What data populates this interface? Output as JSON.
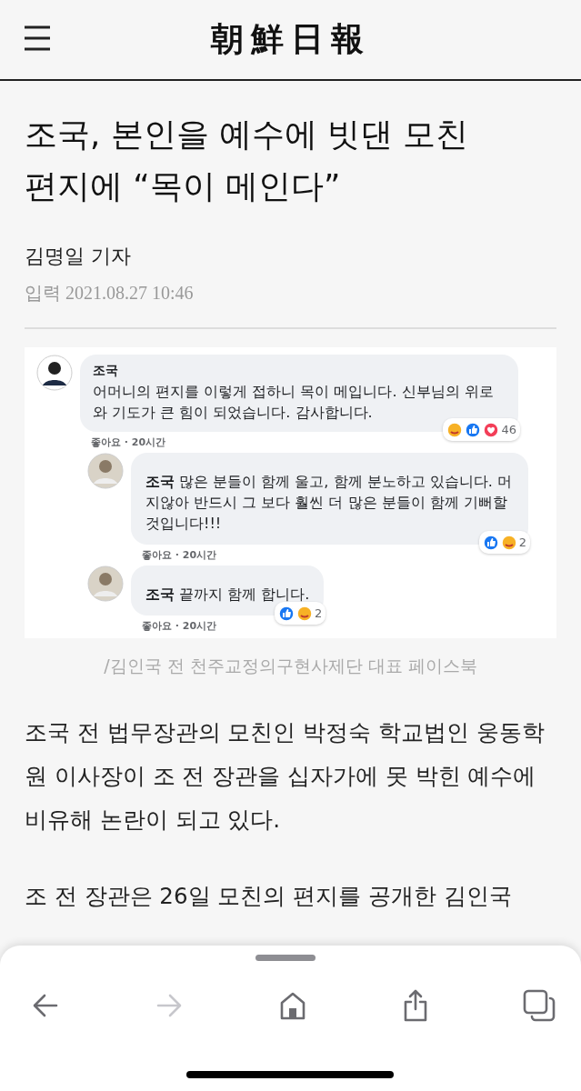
{
  "header": {
    "logo": "朝鮮日報"
  },
  "article": {
    "title": "조국, 본인을 예수에 빗댄 모친 편지에 “목이 메인다”",
    "byline": "김명일 기자",
    "date_label": "입력",
    "date": "2021.08.27 10:46"
  },
  "figure": {
    "comments": [
      {
        "author": "조국",
        "text": "어머니의 편지를 이렇게 접하니 목이 메입니다. 신부님의 위로와 기도가 큰 힘이 되었습니다. 감사합니다.",
        "reactions": [
          {
            "kind": "care"
          },
          {
            "kind": "like"
          },
          {
            "kind": "love"
          }
        ],
        "count": "46",
        "meta": "좋아요 · 20시간",
        "replies": [
          {
            "text": "**조국** 많은 분들이 함께 울고, 함께 분노하고 있습니다. 머지않아 반드시 그 보다 훨씬 더 많은 분들이 함께 기뻐할 것입니다!!!",
            "reactions": [
              {
                "kind": "like"
              },
              {
                "kind": "care"
              }
            ],
            "count": "2",
            "meta": "좋아요 · 20시간"
          },
          {
            "text": "**조국** 끝까지 함께 합니다.",
            "reactions": [
              {
                "kind": "like"
              },
              {
                "kind": "care"
              }
            ],
            "count": "2",
            "meta": "좋아요 · 20시간"
          }
        ]
      }
    ],
    "caption": "/김인국 전 천주교정의구현사제단 대표 페이스북"
  },
  "body": [
    "조국 전 법무장관의 모친인 박정숙 학교법인 웅동학원 이사장이 조 전 장관을 십자가에 못 박힌 예수에 비유해 논란이 되고 있다.",
    "조 전 장관은 26일 모친의 편지를 공개한 김인국"
  ],
  "toolbar": {
    "buttons": [
      {
        "kind": "back",
        "disabled": false
      },
      {
        "kind": "forward",
        "disabled": true
      },
      {
        "kind": "home",
        "disabled": false
      },
      {
        "kind": "share",
        "disabled": false
      },
      {
        "kind": "tabs",
        "disabled": false
      }
    ]
  }
}
